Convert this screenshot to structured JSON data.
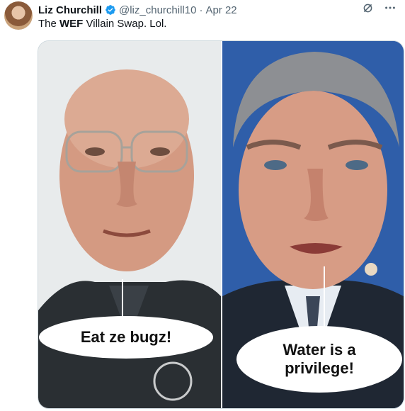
{
  "tweet": {
    "author_name": "Liz Churchill",
    "handle": "@liz_churchill10",
    "separator": "·",
    "date": "Apr 22",
    "text_before": "The ",
    "text_bold": "WEF",
    "text_after": " Villain Swap. Lol."
  },
  "media": {
    "left_caption": "Eat ze bugz!",
    "right_caption_line1": "Water is a",
    "right_caption_line2": "privilege!"
  },
  "colors": {
    "verified": "#1d9bf0",
    "muted": "#536471",
    "border": "#cfd9de"
  },
  "icons": [
    "verified-badge-icon",
    "grok-icon",
    "more-icon"
  ]
}
